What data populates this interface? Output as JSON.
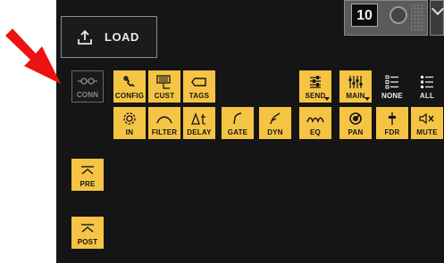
{
  "load": {
    "label": "LOAD",
    "icon": "upload-icon"
  },
  "scene": {
    "number": "10"
  },
  "conn": {
    "label": "CONN",
    "icon": "link-icon"
  },
  "row1": [
    {
      "key": "config",
      "label": "CONFIG",
      "icon": "wrench-icon"
    },
    {
      "key": "cust",
      "label": "CUST",
      "icon": "keyboard-icon"
    },
    {
      "key": "tags",
      "label": "TAGS",
      "icon": "tag-icon"
    },
    {
      "key": "send",
      "label": "SEND",
      "icon": "send-faders-icon"
    },
    {
      "key": "main",
      "label": "MAIN",
      "icon": "main-faders-icon"
    },
    {
      "key": "none",
      "label": "NONE",
      "icon": "list-none-icon"
    },
    {
      "key": "all",
      "label": "ALL",
      "icon": "list-all-icon"
    }
  ],
  "row2": [
    {
      "key": "in",
      "label": "IN",
      "icon": "gear-icon"
    },
    {
      "key": "filter",
      "label": "FILTER",
      "icon": "filter-curve-icon"
    },
    {
      "key": "delay",
      "label": "DELAY",
      "icon": "delta-t-icon"
    },
    {
      "key": "gate",
      "label": "GATE",
      "icon": "gate-curve-icon"
    },
    {
      "key": "dyn",
      "label": "DYN",
      "icon": "dynamics-curve-icon"
    },
    {
      "key": "eq",
      "label": "EQ",
      "icon": "eq-curve-icon"
    },
    {
      "key": "pan",
      "label": "PAN",
      "icon": "pan-knob-icon"
    },
    {
      "key": "fdr",
      "label": "FDR",
      "icon": "fader-icon"
    },
    {
      "key": "mute",
      "label": "MUTE",
      "icon": "mute-speaker-icon"
    }
  ],
  "pre": {
    "label": "PRE",
    "icon": "pre-tap-icon"
  },
  "post": {
    "label": "POST",
    "icon": "post-tap-icon"
  },
  "colors": {
    "accent": "#f5c444",
    "panel": "#151515",
    "arrow": "#ee1111"
  }
}
